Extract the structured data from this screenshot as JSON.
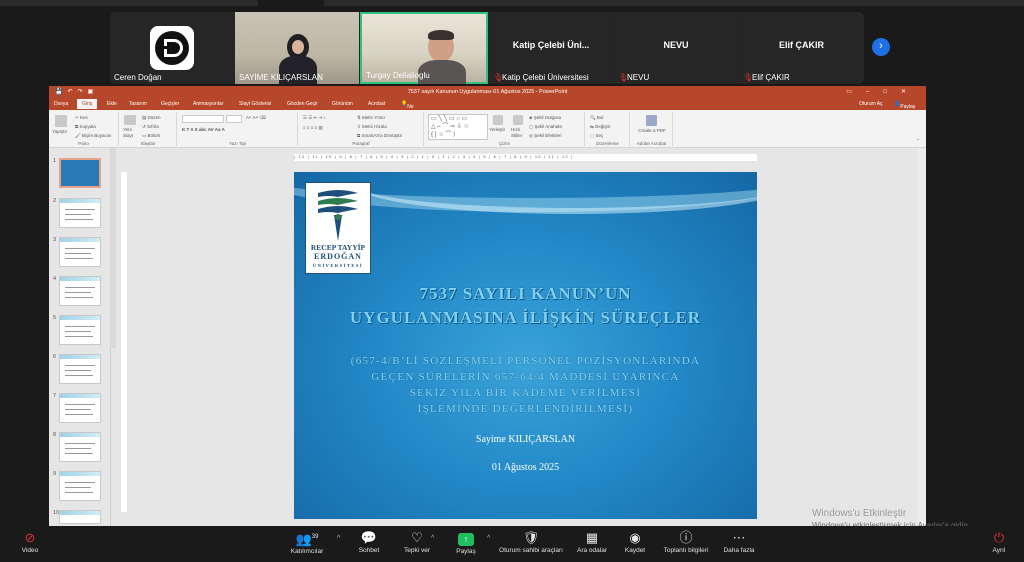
{
  "participants": [
    {
      "name": "Ceren Doğan",
      "muted": false,
      "type": "logo"
    },
    {
      "name": "SAYİME KILIÇARSLAN",
      "muted": false,
      "type": "camera"
    },
    {
      "name": "Turgay Delialioglu",
      "muted": false,
      "type": "camera"
    },
    {
      "name": "Katip Çelebi Üniversitesi",
      "display": "Katip  Çelebi  Üni...",
      "muted": true,
      "type": "text"
    },
    {
      "name": "NEVU",
      "display": "NEVU",
      "muted": true,
      "type": "text"
    },
    {
      "name": "Elif ÇAKIR",
      "display": "Elif ÇAKIR",
      "muted": true,
      "type": "text"
    }
  ],
  "ppt": {
    "window_title": "7537 sayılı Kanunun Uygulanması-01 Ağustos 2025 - PowerPoint",
    "menu": [
      "Dosya",
      "Giriş",
      "Ekle",
      "Tasarım",
      "Geçişler",
      "Animasyonlar",
      "Slayt Gösterisi",
      "Gözden Geçir",
      "Görünüm",
      "Acrobat"
    ],
    "active_menu": "Giriş",
    "tell_me": "Ne yapmak istediğinizi söyleyin...",
    "sign_in": "Oturum Aç",
    "share": "Paylaş",
    "ribbon_groups": {
      "pano": "Pano",
      "slaytlar": "Slaytlar",
      "yazi_tipi": "Yazı Tipi",
      "paragraf": "Paragraf",
      "cizim": "Çizim",
      "duzenleme": "Düzenleme",
      "adobe": "Adobe Acrobat"
    },
    "ribbon_labels": {
      "yapistir": "Yapıştır",
      "kes": "Kes",
      "kopyala": "Kopyala",
      "bicim_boyacisi": "Biçim Boyacısı",
      "yeni_slayt": "Yeni Slayt",
      "duzen": "Düzen",
      "sifirla": "Sıfırla",
      "bolum": "Bölüm",
      "metin_yonu": "Metin Yönü",
      "metni_hizala": "Metni Hizala",
      "smartart": "SmartArt'a Dönüştür",
      "yerlestir": "Yerleştir",
      "hizli_stiller": "Hızlı Stiller",
      "sekil_dolgusu": "Şekil Dolgusu",
      "sekil_anahatti": "Şekil Anahattı",
      "sekil_efektleri": "Şekil Efektleri",
      "bul": "Bul",
      "degistir": "Değiştir",
      "sec": "Seç",
      "create_pdf": "Create a PDF"
    },
    "slide_numbers": [
      "1",
      "2",
      "3",
      "4",
      "5",
      "6",
      "7",
      "8",
      "9",
      "10"
    ],
    "ruler": "| 12 | 11 | 10 | 9 | 8 | 7 | 6 | 5 | 4 | 3 | 2 | 1 | 0 | 1 | 2 | 3 | 4 | 5 | 6 | 7 | 8 | 9 | 10 | 11 | 12 |"
  },
  "slide": {
    "logo_line1": "RECEP TAYYİP",
    "logo_line2": "ERDOĞAN",
    "logo_line3": "ÜNİVERSİTESİ",
    "title_line1": "7537 SAYILI KANUN’UN",
    "title_line2": "UYGULANMASINA İLİŞKİN SÜREÇLER",
    "sub_line1": "(657-4/B’Lİ SÖZLEŞMELİ PERSONEL POZİSYONLARINDA",
    "sub_line2": "GEÇEN SÜRELERİN 657-64/4 MADDESİ UYARINCA",
    "sub_line3": "SEKİZ YILA BİR KADEME VERİLMESİ",
    "sub_line4": "İŞLEMİNDE DEĞERLENDİRİLMESİ)",
    "author": "Sayime KILIÇARSLAN",
    "date": "01 Ağustos 2025"
  },
  "toolbar": {
    "video": "Video",
    "participants": "Katılımcılar",
    "participant_count": "39",
    "chat": "Sohbet",
    "reactions": "Tepki ver",
    "share": "Paylaş",
    "host_tools": "Oturum sahibi araçları",
    "apps": "Ara odalar",
    "record": "Kaydet",
    "meeting_info": "Toplantı bilgileri",
    "more": "Daha fazla",
    "leave": "Ayrıl"
  },
  "windows_watermark": {
    "line1": "Windows'u Etkinleştir",
    "line2": "Windows'u etkinleştirmek için Ayarlar'a gidin."
  }
}
